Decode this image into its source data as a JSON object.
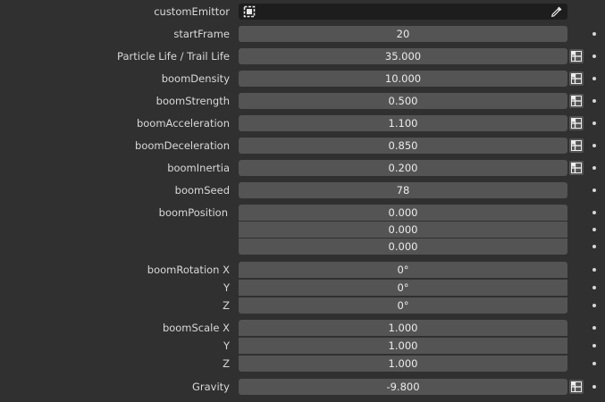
{
  "custom_emitter": {
    "label": "customEmittor",
    "value": ""
  },
  "rows": [
    {
      "label": "startFrame",
      "value": "20"
    },
    {
      "label": "Particle Life / Trail Life",
      "value": "35.000"
    },
    {
      "label": "boomDensity",
      "value": "10.000"
    },
    {
      "label": "boomStrength",
      "value": "0.500"
    },
    {
      "label": "boomAcceleration",
      "value": "1.100"
    },
    {
      "label": "boomDeceleration",
      "value": "0.850"
    },
    {
      "label": "boomInertia",
      "value": "0.200"
    },
    {
      "label": "boomSeed",
      "value": "78"
    }
  ],
  "boom_position": {
    "label": "boomPosition",
    "values": [
      "0.000",
      "0.000",
      "0.000"
    ]
  },
  "boom_rotation": {
    "labels": [
      "boomRotation X",
      "Y",
      "Z"
    ],
    "values": [
      "0°",
      "0°",
      "0°"
    ]
  },
  "boom_scale": {
    "labels": [
      "boomScale X",
      "Y",
      "Z"
    ],
    "values": [
      "1.000",
      "1.000",
      "1.000"
    ]
  },
  "gravity": {
    "label": "Gravity",
    "value": "-9.800"
  },
  "icons": {
    "object": "object-icon",
    "eyedropper": "eyedropper-icon",
    "keyframe_toggle": "keyframe-toggle-icon",
    "animate_dot": "animate-property-dot"
  }
}
